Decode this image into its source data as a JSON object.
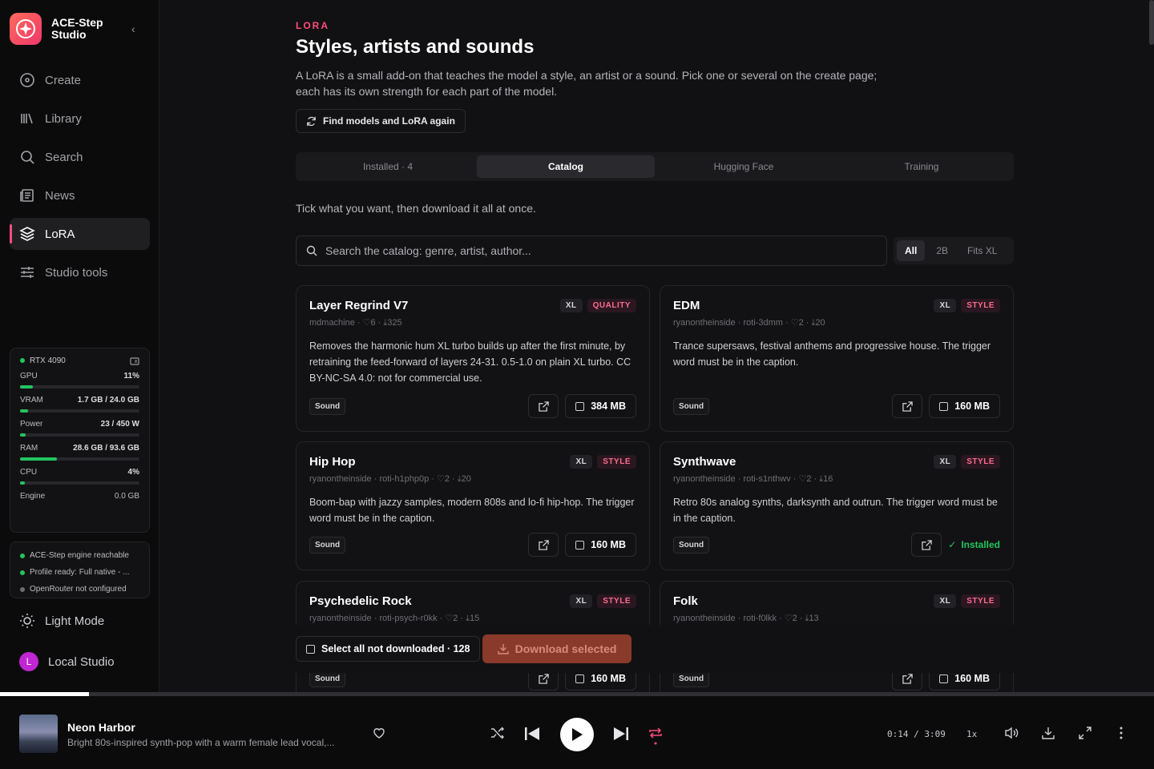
{
  "app": {
    "name": "ACE-Step Studio"
  },
  "nav": [
    {
      "label": "Create",
      "icon": "create-icon"
    },
    {
      "label": "Library",
      "icon": "library-icon"
    },
    {
      "label": "Search",
      "icon": "search-icon"
    },
    {
      "label": "News",
      "icon": "news-icon"
    },
    {
      "label": "LoRA",
      "icon": "layers-icon",
      "active": true
    },
    {
      "label": "Studio tools",
      "icon": "sliders-icon"
    }
  ],
  "system": {
    "gpu_name": "RTX 4090",
    "metrics": [
      {
        "label": "GPU",
        "value": "11%",
        "fraction": 0.11
      },
      {
        "label": "VRAM",
        "value": "1.7 GB / 24.0 GB",
        "fraction": 0.07
      },
      {
        "label": "Power",
        "value": "23 / 450 W",
        "fraction": 0.05
      },
      {
        "label": "RAM",
        "value": "28.6 GB / 93.6 GB",
        "fraction": 0.31
      },
      {
        "label": "CPU",
        "value": "4%",
        "fraction": 0.04
      },
      {
        "label": "Engine",
        "value": "0.0 GB"
      }
    ]
  },
  "status": [
    {
      "text": "ACE-Step engine reachable",
      "color": "#22c55e"
    },
    {
      "text": "Profile ready: Full native - ...",
      "color": "#22c55e"
    },
    {
      "text": "OpenRouter not configured",
      "color": "#6b6b70"
    }
  ],
  "light_mode": "Light Mode",
  "user": {
    "initial": "L",
    "name": "Local Studio"
  },
  "page": {
    "eyebrow": "LORA",
    "title": "Styles, artists and sounds",
    "description": "A LoRA is a small add-on that teaches the model a style, an artist or a sound. Pick one or several on the create page; each has its own strength for each part of the model.",
    "refresh_button": "Find models and LoRA again",
    "tabs": [
      "Installed · 4",
      "Catalog",
      "Hugging Face",
      "Training"
    ],
    "active_tab": "Catalog",
    "hint": "Tick what you want, then download it all at once.",
    "search_placeholder": "Search the catalog: genre, artist, author...",
    "filters": [
      "All",
      "2B",
      "Fits XL"
    ],
    "active_filter": "All"
  },
  "cards": [
    {
      "title": "Layer Regrind V7",
      "tags": [
        "XL",
        "QUALITY"
      ],
      "meta": "mdmachine · ♡6 · ⤓325",
      "desc": "Removes the harmonic hum XL turbo builds up after the first minute, by retraining the feed-forward of layers 24-31. 0.5-1.0 on plain XL turbo. CC BY-NC-SA 4.0: not for commercial use.",
      "chip": "Sound",
      "size": "384 MB"
    },
    {
      "title": "EDM",
      "tags": [
        "XL",
        "STYLE"
      ],
      "meta": "ryanontheinside · roti-3dmm · ♡2 · ⤓20",
      "desc": "Trance supersaws, festival anthems and progressive house. The trigger word must be in the caption.",
      "chip": "Sound",
      "size": "160 MB"
    },
    {
      "title": "Hip Hop",
      "tags": [
        "XL",
        "STYLE"
      ],
      "meta": "ryanontheinside · roti-h1php0p · ♡2 · ⤓20",
      "desc": "Boom-bap with jazzy samples, modern 808s and lo-fi hip-hop. The trigger word must be in the caption.",
      "chip": "Sound",
      "size": "160 MB"
    },
    {
      "title": "Synthwave",
      "tags": [
        "XL",
        "STYLE"
      ],
      "meta": "ryanontheinside · roti-s1nthwv · ♡2 · ⤓16",
      "desc": "Retro 80s analog synths, darksynth and outrun. The trigger word must be in the caption.",
      "chip": "Sound",
      "installed": "Installed"
    },
    {
      "title": "Psychedelic Rock",
      "tags": [
        "XL",
        "STYLE"
      ],
      "meta": "ryanontheinside · roti-psych-r0kk · ♡2 · ⤓15",
      "chip": "Sound",
      "size": "160 MB"
    },
    {
      "title": "Folk",
      "tags": [
        "XL",
        "STYLE"
      ],
      "meta": "ryanontheinside · roti-f0lkk · ♡2 · ⤓13",
      "chip": "Sound",
      "size": "160 MB"
    }
  ],
  "bulk": {
    "select_all": "Select all not downloaded · 128",
    "download": "Download selected"
  },
  "player": {
    "title": "Neon Harbor",
    "subtitle": "Bright 80s-inspired synth-pop with a warm female lead vocal,...",
    "time": "0:14 / 3:09",
    "speed": "1x",
    "progress": 0.077
  },
  "colors": {
    "accent": "#ff4d7a",
    "ok": "#22c55e"
  }
}
